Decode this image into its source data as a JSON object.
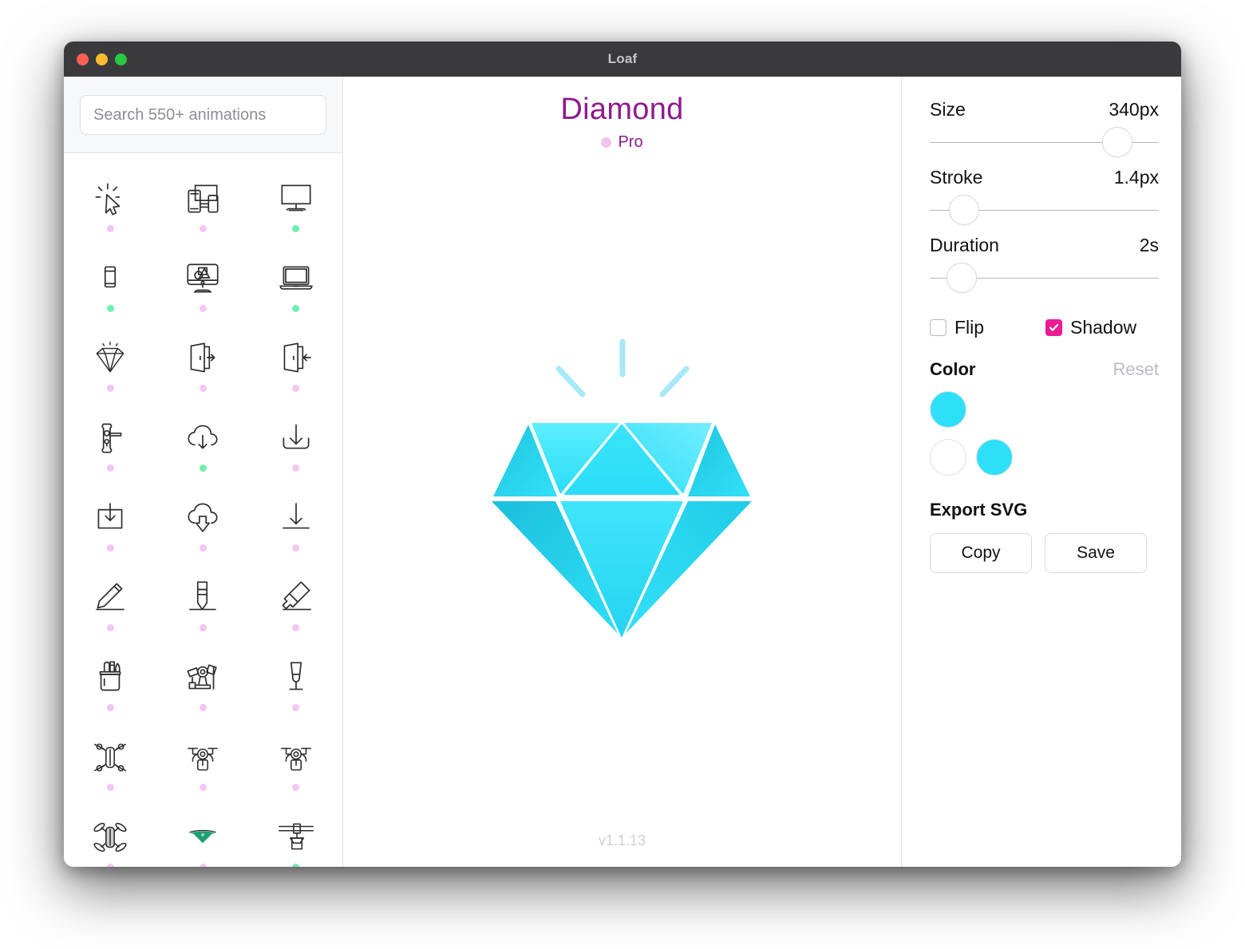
{
  "window": {
    "title": "Loaf",
    "traffic_lights": [
      {
        "name": "close",
        "color": "#ff5f57"
      },
      {
        "name": "minimize",
        "color": "#febc2e"
      },
      {
        "name": "zoom",
        "color": "#28c840"
      }
    ]
  },
  "sidebar": {
    "search": {
      "placeholder": "Search 550+ animations",
      "value": ""
    },
    "icons": [
      {
        "name": "cursor-click-icon",
        "tier": "pro"
      },
      {
        "name": "responsive-devices-icon",
        "tier": "pro"
      },
      {
        "name": "desktop-monitor-icon",
        "tier": "free"
      },
      {
        "name": "smartphone-icon",
        "tier": "free"
      },
      {
        "name": "design-monitor-icon",
        "tier": "pro"
      },
      {
        "name": "laptop-icon",
        "tier": "free"
      },
      {
        "name": "diamond-icon",
        "tier": "pro"
      },
      {
        "name": "door-exit-icon",
        "tier": "pro"
      },
      {
        "name": "door-enter-icon",
        "tier": "pro"
      },
      {
        "name": "door-handle-lock-icon",
        "tier": "pro"
      },
      {
        "name": "cloud-download-icon",
        "tier": "free"
      },
      {
        "name": "download-tray-icon",
        "tier": "pro"
      },
      {
        "name": "download-box-icon",
        "tier": "pro"
      },
      {
        "name": "cloud-download-filled-icon",
        "tier": "pro"
      },
      {
        "name": "download-line-icon",
        "tier": "pro"
      },
      {
        "name": "pencil-draw-icon",
        "tier": "pro"
      },
      {
        "name": "pencil-vertical-icon",
        "tier": "pro"
      },
      {
        "name": "marker-highlight-icon",
        "tier": "pro"
      },
      {
        "name": "pen-cup-icon",
        "tier": "pro"
      },
      {
        "name": "film-camera-icon",
        "tier": "pro"
      },
      {
        "name": "champagne-flute-icon",
        "tier": "pro"
      },
      {
        "name": "drone-quadcopter-icon",
        "tier": "pro"
      },
      {
        "name": "drone-front-icon",
        "tier": "pro"
      },
      {
        "name": "drone-front-alt-icon",
        "tier": "pro"
      },
      {
        "name": "drone-tilt-icon",
        "tier": "pro"
      },
      {
        "name": "drone-hover-icon",
        "tier": "pro"
      },
      {
        "name": "crane-hook-icon",
        "tier": "free"
      }
    ]
  },
  "preview": {
    "title": "Diamond",
    "badge": "Pro",
    "version": "v1.1.13",
    "art": {
      "name": "diamond-illustration",
      "color_light": "#37E6FB",
      "color_mid": "#25D6F2",
      "color_deep": "#1FC5DE",
      "spark_color": "#A6E9F7"
    }
  },
  "panel": {
    "controls": [
      {
        "label": "Size",
        "value": "340px",
        "percent": 82,
        "name": "size-slider"
      },
      {
        "label": "Stroke",
        "value": "1.4px",
        "percent": 15,
        "name": "stroke-slider"
      },
      {
        "label": "Duration",
        "value": "2s",
        "percent": 14,
        "name": "duration-slider"
      }
    ],
    "toggles": [
      {
        "label": "Flip",
        "checked": false,
        "name": "flip-checkbox"
      },
      {
        "label": "Shadow",
        "checked": true,
        "name": "shadow-checkbox",
        "accent": "#ec1c96"
      }
    ],
    "color": {
      "title": "Color",
      "reset_label": "Reset",
      "primary": "#2EE0F7",
      "palette": [
        "#ffffff",
        "#2EE0F7"
      ]
    },
    "export": {
      "title": "Export SVG",
      "copy_label": "Copy",
      "save_label": "Save"
    }
  }
}
